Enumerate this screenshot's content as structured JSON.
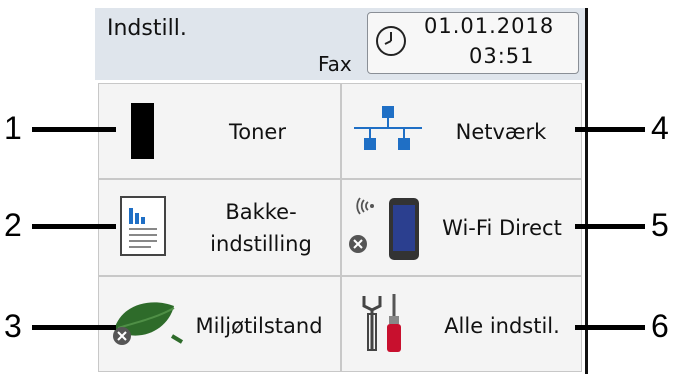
{
  "header": {
    "title": "Indstill.",
    "fax_label": "Fax",
    "date": "01.01.2018",
    "time": "03:51"
  },
  "tiles": [
    {
      "label": "Toner",
      "icon": "toner-icon"
    },
    {
      "label": "Netværk",
      "icon": "network-icon"
    },
    {
      "label_line1": "Bakke-",
      "label_line2": "indstilling",
      "icon": "tray-settings-icon"
    },
    {
      "label": "Wi-Fi Direct",
      "icon": "wifi-direct-icon"
    },
    {
      "label": "Miljøtilstand",
      "icon": "eco-leaf-icon"
    },
    {
      "label": "Alle indstil.",
      "icon": "tools-icon"
    }
  ],
  "callouts": [
    "1",
    "2",
    "3",
    "4",
    "5",
    "6"
  ],
  "colors": {
    "header_bg": "#dfe5ec",
    "tile_bg": "#f4f4f4",
    "network_blue": "#1f6fc5",
    "leaf_green": "#2e6b2a",
    "screwdriver_red": "#c8102e"
  }
}
